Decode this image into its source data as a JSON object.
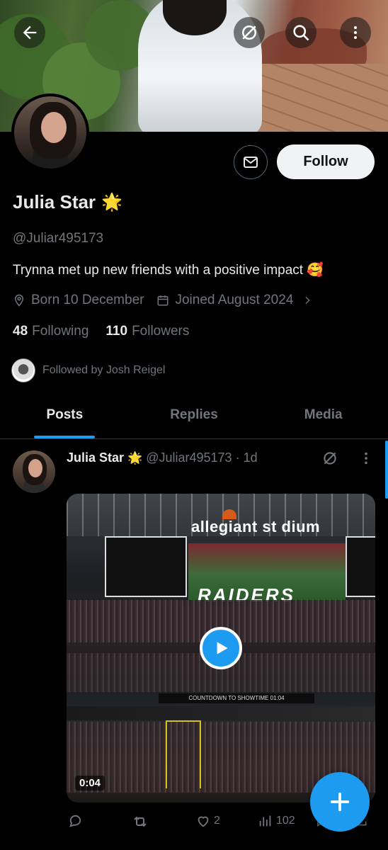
{
  "profile": {
    "name": "Julia Star",
    "name_emoji": "🌟",
    "handle": "@Juliar495173",
    "bio": "Trynna met up new friends with a positive impact 🥰",
    "born": "Born 10 December",
    "joined": "Joined August 2024",
    "following_count": "48",
    "following_label": "Following",
    "followers_count": "110",
    "followers_label": "Followers",
    "followed_by": "Followed by Josh Reigel"
  },
  "actions": {
    "follow_label": "Follow"
  },
  "tabs": [
    {
      "label": "Posts",
      "active": true
    },
    {
      "label": "Replies",
      "active": false
    },
    {
      "label": "Media",
      "active": false
    }
  ],
  "post": {
    "name": "Julia Star",
    "name_emoji": "🌟",
    "handle": "@Juliar495173",
    "time": "· 1d",
    "media": {
      "stadium_text": "allegiant st dium",
      "team_text": "RAIDERS",
      "band_text": "COUNTDOWN TO SHOWTIME 01:04",
      "duration": "0:04"
    },
    "stats": {
      "likes": "2",
      "views": "102"
    }
  },
  "colors": {
    "accent": "#1d9bf0",
    "background": "#000000",
    "text": "#e7e9ea",
    "muted": "#71767b"
  }
}
